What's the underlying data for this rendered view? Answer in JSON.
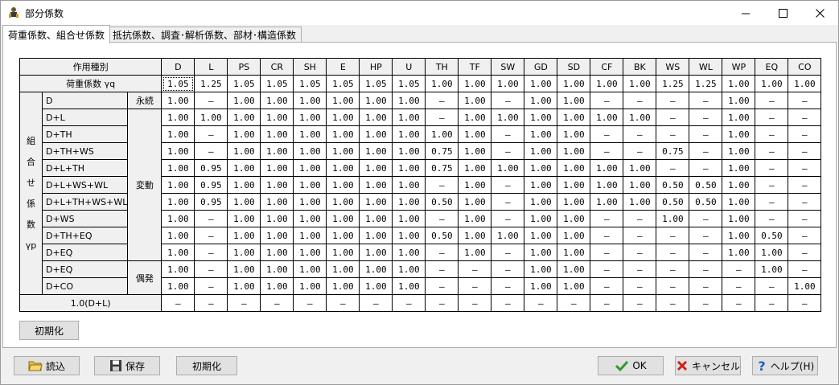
{
  "window": {
    "title": "部分係数",
    "icon": "app-figure-icon",
    "controls": [
      "minimize-icon",
      "maximize-icon",
      "close-icon"
    ]
  },
  "tabs": [
    {
      "label": "荷重係数、組合せ係数",
      "active": true
    },
    {
      "label": "抵抗係数、調査･解析係数、部材･構造係数",
      "active": false
    }
  ],
  "table": {
    "corner_label": "作用種別",
    "columns": [
      "D",
      "L",
      "PS",
      "CR",
      "SH",
      "E",
      "HP",
      "U",
      "TH",
      "TF",
      "SW",
      "GD",
      "SD",
      "CF",
      "BK",
      "WS",
      "WL",
      "WP",
      "EQ",
      "CO"
    ],
    "load_factor_label": "荷重係数 γq",
    "load_factors": [
      "1.05",
      "1.25",
      "1.05",
      "1.05",
      "1.05",
      "1.05",
      "1.05",
      "1.05",
      "1.00",
      "1.00",
      "1.00",
      "1.00",
      "1.00",
      "1.00",
      "1.00",
      "1.25",
      "1.25",
      "1.00",
      "1.00",
      "1.00"
    ],
    "group_label_chars": [
      "組",
      "合",
      "せ",
      "係",
      "数",
      "γp"
    ],
    "categories": {
      "permanent": "永続",
      "variable": "変動",
      "accidental": "偶発"
    },
    "combinations": [
      {
        "name": "D",
        "values": [
          "1.00",
          "—",
          "1.00",
          "1.00",
          "1.00",
          "1.00",
          "1.00",
          "1.00",
          "—",
          "1.00",
          "—",
          "1.00",
          "1.00",
          "—",
          "—",
          "—",
          "—",
          "1.00",
          "—",
          "—"
        ]
      },
      {
        "name": "D+L",
        "values": [
          "1.00",
          "1.00",
          "1.00",
          "1.00",
          "1.00",
          "1.00",
          "1.00",
          "1.00",
          "—",
          "1.00",
          "1.00",
          "1.00",
          "1.00",
          "1.00",
          "1.00",
          "—",
          "—",
          "1.00",
          "—",
          "—"
        ]
      },
      {
        "name": "D+TH",
        "values": [
          "1.00",
          "—",
          "1.00",
          "1.00",
          "1.00",
          "1.00",
          "1.00",
          "1.00",
          "1.00",
          "1.00",
          "—",
          "1.00",
          "1.00",
          "—",
          "—",
          "—",
          "—",
          "1.00",
          "—",
          "—"
        ]
      },
      {
        "name": "D+TH+WS",
        "values": [
          "1.00",
          "—",
          "1.00",
          "1.00",
          "1.00",
          "1.00",
          "1.00",
          "1.00",
          "0.75",
          "1.00",
          "—",
          "1.00",
          "1.00",
          "—",
          "—",
          "0.75",
          "—",
          "1.00",
          "—",
          "—"
        ]
      },
      {
        "name": "D+L+TH",
        "values": [
          "1.00",
          "0.95",
          "1.00",
          "1.00",
          "1.00",
          "1.00",
          "1.00",
          "1.00",
          "0.75",
          "1.00",
          "1.00",
          "1.00",
          "1.00",
          "1.00",
          "1.00",
          "—",
          "—",
          "1.00",
          "—",
          "—"
        ]
      },
      {
        "name": "D+L+WS+WL",
        "values": [
          "1.00",
          "0.95",
          "1.00",
          "1.00",
          "1.00",
          "1.00",
          "1.00",
          "1.00",
          "—",
          "1.00",
          "—",
          "1.00",
          "1.00",
          "1.00",
          "1.00",
          "0.50",
          "0.50",
          "1.00",
          "—",
          "—"
        ]
      },
      {
        "name": "D+L+TH+WS+WL",
        "values": [
          "1.00",
          "0.95",
          "1.00",
          "1.00",
          "1.00",
          "1.00",
          "1.00",
          "1.00",
          "0.50",
          "1.00",
          "—",
          "1.00",
          "1.00",
          "1.00",
          "1.00",
          "0.50",
          "0.50",
          "1.00",
          "—",
          "—"
        ]
      },
      {
        "name": "D+WS",
        "values": [
          "1.00",
          "—",
          "1.00",
          "1.00",
          "1.00",
          "1.00",
          "1.00",
          "1.00",
          "—",
          "1.00",
          "—",
          "1.00",
          "1.00",
          "—",
          "—",
          "1.00",
          "—",
          "1.00",
          "—",
          "—"
        ]
      },
      {
        "name": "D+TH+EQ",
        "values": [
          "1.00",
          "—",
          "1.00",
          "1.00",
          "1.00",
          "1.00",
          "1.00",
          "1.00",
          "0.50",
          "1.00",
          "1.00",
          "1.00",
          "1.00",
          "—",
          "—",
          "—",
          "—",
          "1.00",
          "0.50",
          "—"
        ]
      },
      {
        "name": "D+EQ",
        "values": [
          "1.00",
          "—",
          "1.00",
          "1.00",
          "1.00",
          "1.00",
          "1.00",
          "1.00",
          "—",
          "1.00",
          "—",
          "1.00",
          "1.00",
          "—",
          "—",
          "—",
          "—",
          "1.00",
          "1.00",
          "—"
        ]
      },
      {
        "name": "D+EQ",
        "values": [
          "1.00",
          "—",
          "1.00",
          "1.00",
          "1.00",
          "1.00",
          "1.00",
          "1.00",
          "—",
          "—",
          "—",
          "1.00",
          "1.00",
          "—",
          "—",
          "—",
          "—",
          "—",
          "1.00",
          "—"
        ]
      },
      {
        "name": "D+CO",
        "values": [
          "1.00",
          "—",
          "1.00",
          "1.00",
          "1.00",
          "1.00",
          "1.00",
          "1.00",
          "—",
          "—",
          "—",
          "1.00",
          "1.00",
          "—",
          "—",
          "—",
          "—",
          "—",
          "—",
          "1.00"
        ]
      }
    ],
    "footer_label": "1.0(D+L)",
    "footer_values": [
      "—",
      "—",
      "—",
      "—",
      "—",
      "—",
      "—",
      "—",
      "—",
      "—",
      "—",
      "—",
      "—",
      "—",
      "—",
      "—",
      "—",
      "—",
      "—",
      "—"
    ]
  },
  "panel_buttons": {
    "init": "初期化"
  },
  "bottom_buttons": {
    "load": "読込",
    "save": "保存",
    "init": "初期化",
    "ok": "OK",
    "cancel": "キャンセル",
    "help": "ヘルプ(H)"
  },
  "icons": {
    "load": "folder-open-icon",
    "save": "floppy-disk-icon",
    "ok": "check-icon",
    "cancel": "x-mark-icon",
    "help": "question-icon"
  },
  "colors": {
    "ok_check": "#2e9a2e",
    "cancel_x": "#cc2020",
    "help_q": "#2060c0"
  }
}
